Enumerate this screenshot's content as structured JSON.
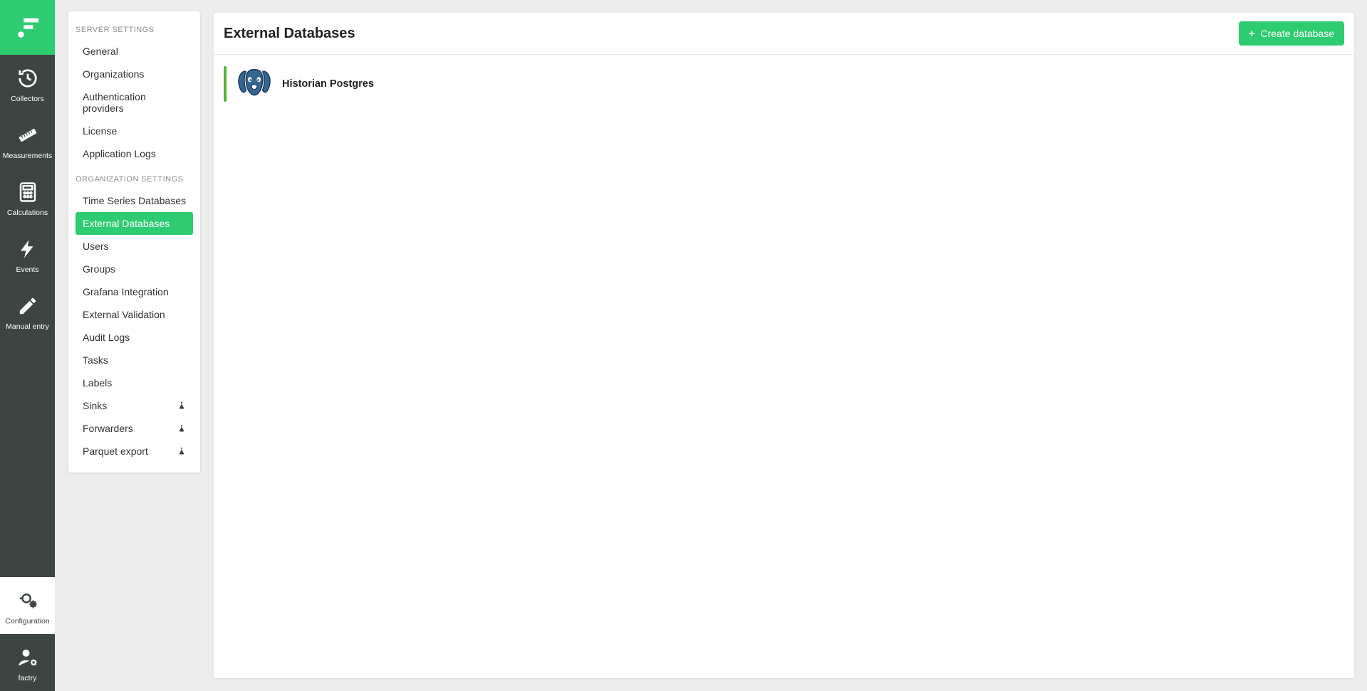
{
  "colors": {
    "accent": "#2ecc71",
    "railBg": "#3d4543",
    "statusOk": "#58b236"
  },
  "rail": {
    "items": [
      {
        "key": "collectors",
        "label": "Collectors",
        "icon": "history-icon"
      },
      {
        "key": "measurements",
        "label": "Measurements",
        "icon": "ruler-icon"
      },
      {
        "key": "calculations",
        "label": "Calculations",
        "icon": "calculator-icon"
      },
      {
        "key": "events",
        "label": "Events",
        "icon": "bolt-icon"
      },
      {
        "key": "manual-entry",
        "label": "Manual entry",
        "icon": "pencil-icon"
      },
      {
        "key": "configuration",
        "label": "Configuration",
        "icon": "gears-icon",
        "active": true
      },
      {
        "key": "factry",
        "label": "factry",
        "icon": "user-gear-icon"
      }
    ]
  },
  "settings": {
    "server_title": "SERVER SETTINGS",
    "org_title": "ORGANIZATION SETTINGS",
    "server_items": [
      {
        "label": "General"
      },
      {
        "label": "Organizations"
      },
      {
        "label": "Authentication providers"
      },
      {
        "label": "License"
      },
      {
        "label": "Application Logs"
      }
    ],
    "org_items": [
      {
        "label": "Time Series Databases"
      },
      {
        "label": "External Databases",
        "active": true
      },
      {
        "label": "Users"
      },
      {
        "label": "Groups"
      },
      {
        "label": "Grafana Integration"
      },
      {
        "label": "External Validation"
      },
      {
        "label": "Audit Logs"
      },
      {
        "label": "Tasks"
      },
      {
        "label": "Labels"
      },
      {
        "label": "Sinks",
        "flask": true
      },
      {
        "label": "Forwarders",
        "flask": true
      },
      {
        "label": "Parquet export",
        "flask": true
      }
    ]
  },
  "main": {
    "title": "External Databases",
    "create_button": "Create database",
    "databases": [
      {
        "name": "Historian Postgres",
        "icon": "postgres-icon",
        "status": "ok"
      }
    ]
  }
}
